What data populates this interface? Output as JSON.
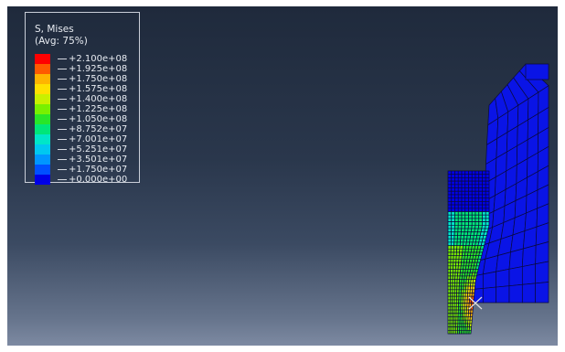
{
  "legend": {
    "title": "S, Mises",
    "averaging": "(Avg: 75%)",
    "levels": [
      "+2.100e+08",
      "+1.925e+08",
      "+1.750e+08",
      "+1.575e+08",
      "+1.400e+08",
      "+1.225e+08",
      "+1.050e+08",
      "+8.752e+07",
      "+7.001e+07",
      "+5.251e+07",
      "+3.501e+07",
      "+1.750e+07",
      "+0.000e+00"
    ],
    "colors": [
      "#ff0000",
      "#ff5a00",
      "#ffb400",
      "#ffe000",
      "#c8f000",
      "#78f000",
      "#28e628",
      "#00e678",
      "#00e6c8",
      "#00c8f0",
      "#0096ff",
      "#0050ff",
      "#0000e6"
    ]
  },
  "viewport": {
    "background_top": "#1f2a3c",
    "background_bottom": "#7d8aa2"
  },
  "model": {
    "part_color": "#0a14e6",
    "mesh_color": "#0a0a3c",
    "marker_icon": "x-marker-icon"
  }
}
